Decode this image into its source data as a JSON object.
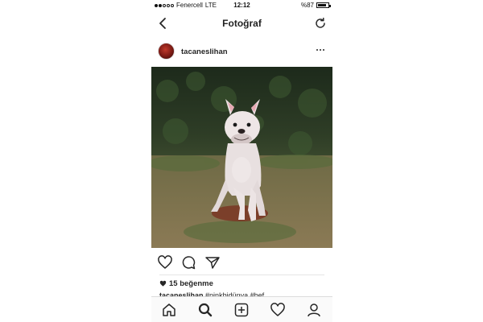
{
  "status_bar": {
    "carrier": "Fenercell",
    "network": "LTE",
    "time": "12:12",
    "battery": "%87",
    "battery_level": 0.87,
    "signal_bars": 2
  },
  "nav": {
    "title": "Fotoğraf",
    "back_icon": "chevron-left-icon",
    "refresh_icon": "refresh-icon"
  },
  "post": {
    "username": "tacaneslihan",
    "more_icon": "more-horizontal-icon"
  },
  "actions": {
    "icons": [
      "heart-icon",
      "comment-icon",
      "share-icon"
    ]
  },
  "likes": {
    "text": "15 beğenme"
  },
  "caption": {
    "username": "tacaneslihan",
    "text": "#pinkbidünya #bef"
  },
  "tabbar": {
    "icons": [
      "home-icon",
      "search-icon",
      "add-icon",
      "activity-icon",
      "profile-icon"
    ]
  }
}
